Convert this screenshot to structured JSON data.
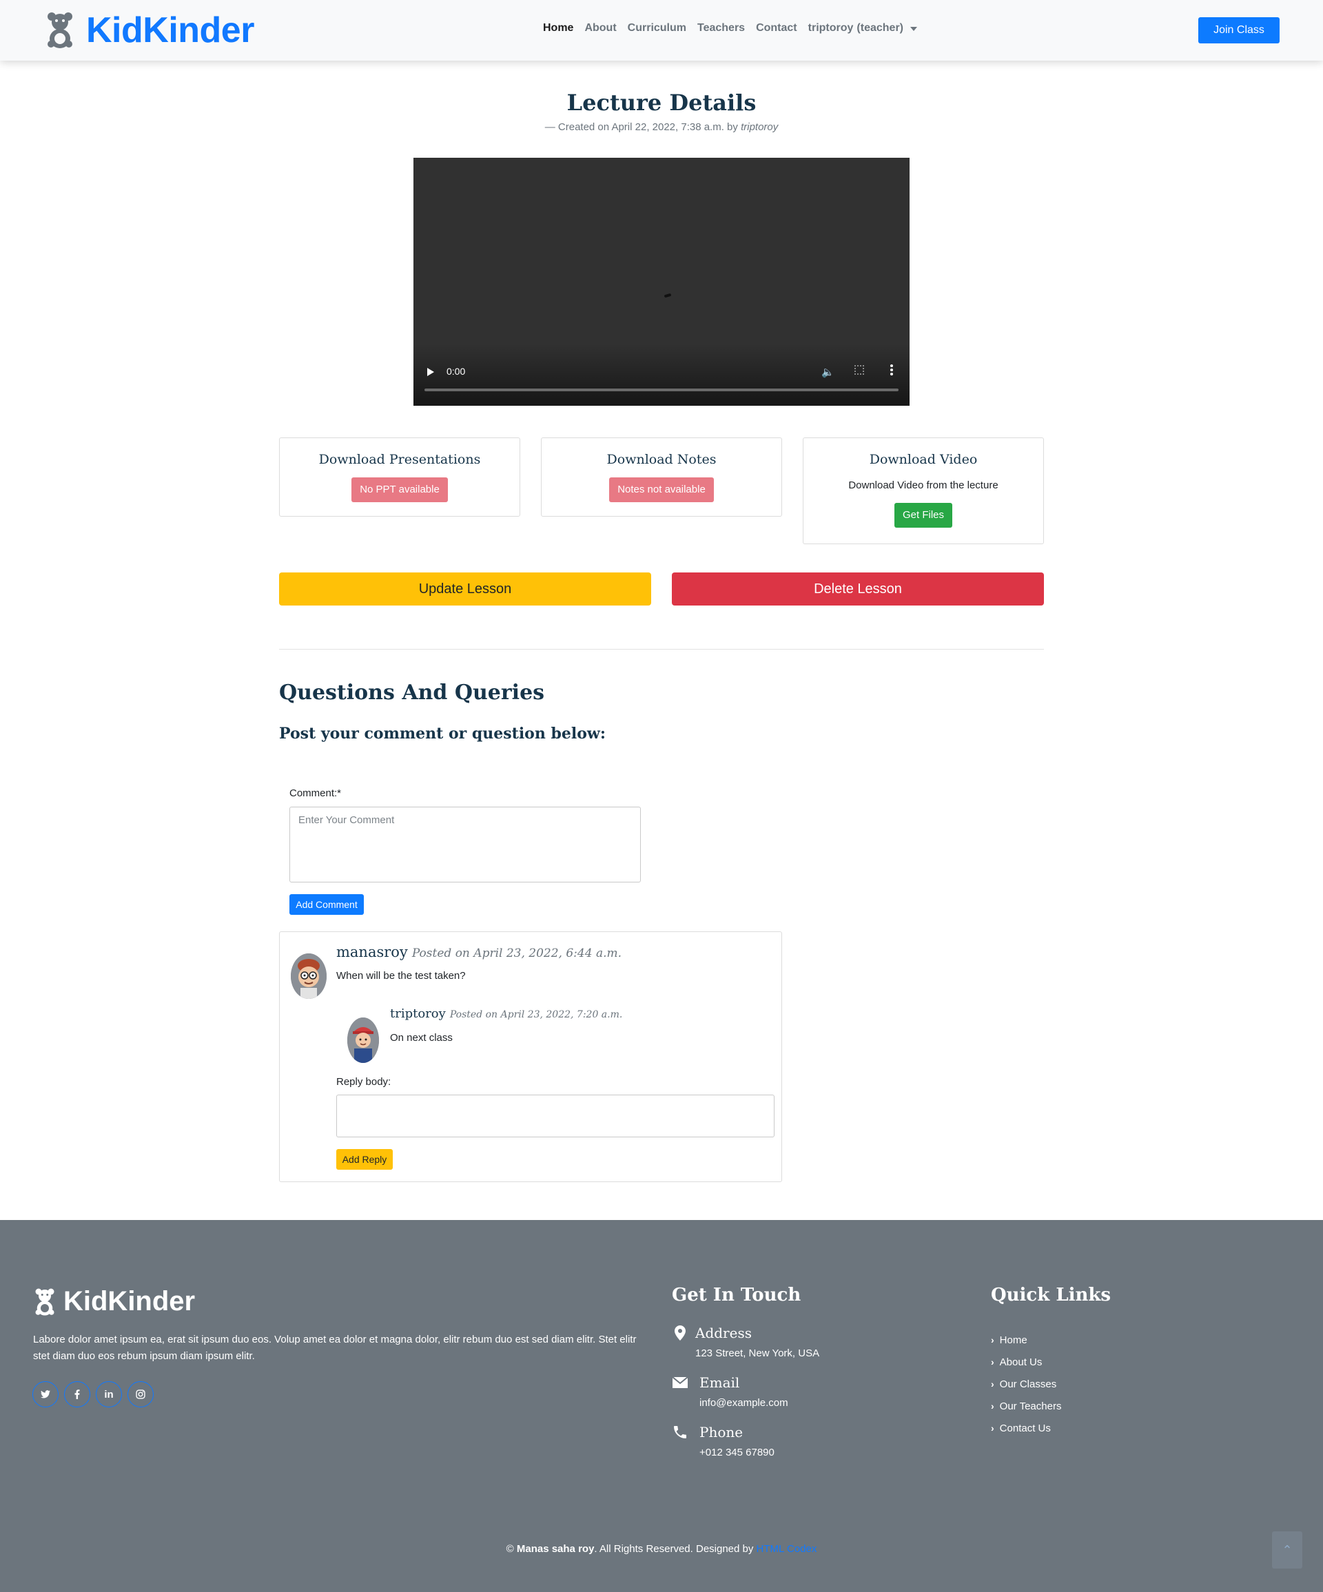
{
  "navbar": {
    "brand": "KidKinder",
    "links": [
      "Home",
      "About",
      "Curriculum",
      "Teachers",
      "Contact"
    ],
    "active_link": "Home",
    "user_name": "triptoroy",
    "user_role": "(teacher)",
    "join_label": "Join Class"
  },
  "lecture": {
    "title": "Lecture Details",
    "meta_prefix": "— Created on April 22, 2022, 7:38 a.m. by",
    "author": "triptoroy"
  },
  "video": {
    "time": "0:00",
    "progress": 0
  },
  "cards": [
    {
      "title": "Download Presentations",
      "button": "No PPT available"
    },
    {
      "title": "Download Notes",
      "button": "Notes not available"
    },
    {
      "title": "Download Video",
      "text": "Download Video from the lecture",
      "button": "Get Files"
    }
  ],
  "lesson_actions": {
    "update_label": "Update Lesson",
    "delete_label": "Delete Lesson"
  },
  "questions": {
    "title": "Questions And Queries",
    "subtitle": "Post your comment or question below:",
    "comment_label": "Comment:*",
    "comment_placeholder": "Enter Your Comment",
    "add_comment_label": "Add Comment"
  },
  "thread": {
    "comment": {
      "user": "manasroy",
      "posted": "Posted on April 23, 2022, 6:44 a.m.",
      "body": "When will be the test taken?"
    },
    "reply": {
      "user": "triptoroy",
      "posted": "Posted on April 23, 2022, 7:20 a.m.",
      "body": "On next class"
    },
    "reply_label": "Reply body:",
    "add_reply_label": "Add Reply"
  },
  "footer": {
    "brand": "KidKinder",
    "about": "Labore dolor amet ipsum ea, erat sit ipsum duo eos. Volup amet ea dolor et magna dolor, elitr rebum duo est sed diam elitr. Stet elitr stet diam duo eos rebum ipsum diam ipsum elitr.",
    "socials": [
      "twitter-icon",
      "facebook-icon",
      "linkedin-icon",
      "instagram-icon"
    ],
    "get_in_touch": {
      "title": "Get In Touch",
      "address_label": "Address",
      "address": "123 Street, New York, USA",
      "email_label": "Email",
      "email": "info@example.com",
      "phone_label": "Phone",
      "phone": "+012 345 67890"
    },
    "quick_links": {
      "title": "Quick Links",
      "items": [
        "Home",
        "About Us",
        "Our Classes",
        "Our Teachers",
        "Contact Us"
      ]
    },
    "copyright": {
      "prefix": "©",
      "owner": "Manas saha roy",
      "middle": ". All Rights Reserved. Designed by",
      "designer": "HTML Codex"
    }
  },
  "colors": {
    "primary": "#0d7bff",
    "brand": "#1179ff",
    "warning": "#ffc107",
    "danger": "#dc3545",
    "success": "#28a745",
    "footer_bg": "#6c757d",
    "heading": "#17354a"
  }
}
